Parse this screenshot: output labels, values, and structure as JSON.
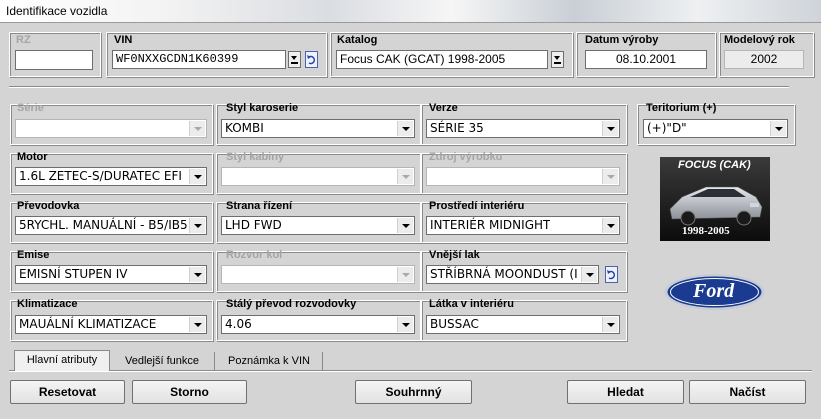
{
  "window": {
    "title": "Identifikace vozidla"
  },
  "top": {
    "rz": {
      "label": "RZ",
      "value": ""
    },
    "vin": {
      "label": "VIN",
      "value": "WF0NXXGCDN1K60399"
    },
    "katalog": {
      "label": "Katalog",
      "value": "Focus CAK (GCAT) 1998-2005"
    },
    "datum": {
      "label": "Datum výroby",
      "value": "08.10.2001"
    },
    "rok": {
      "label": "Modelový rok",
      "value": "2002"
    }
  },
  "attrs": {
    "serie": {
      "label": "Série",
      "value": ""
    },
    "styl_karoserie": {
      "label": "Styl karoserie",
      "value": "KOMBI"
    },
    "verze": {
      "label": "Verze",
      "value": "SÉRIE 35"
    },
    "teritorium": {
      "label": "Teritorium (+)",
      "value": "(+)\"D\""
    },
    "motor": {
      "label": "Motor",
      "value": "1.6L ZETEC-S/DURATEC EFI"
    },
    "styl_kabiny": {
      "label": "Styl kabiny",
      "value": ""
    },
    "zdroj_vyrobku": {
      "label": "Zdroj výrobku",
      "value": ""
    },
    "prevodovka": {
      "label": "Převodovka",
      "value": "5RYCHL. MANUÁLNÍ - B5/IB5"
    },
    "strana_rizeni": {
      "label": "Strana řízení",
      "value": "LHD FWD"
    },
    "prostredi_interieru": {
      "label": "Prostředí interiéru",
      "value": "INTERIÉR MIDNIGHT"
    },
    "emise": {
      "label": "Emise",
      "value": "EMISNÍ STUPEN IV"
    },
    "rozvor_kol": {
      "label": "Rozvor kol",
      "value": ""
    },
    "vnejsi_lak": {
      "label": "Vnější lak",
      "value": "STŘÍBRNÁ MOONDUST (I"
    },
    "klimatizace": {
      "label": "Klimatizace",
      "value": "MAUÁLNÍ KLIMATIZACE"
    },
    "staly_prevod": {
      "label": "Stálý převod rozvodovky",
      "value": "4.06"
    },
    "latka": {
      "label": "Látka v interiéru",
      "value": "BUSSAC"
    }
  },
  "image": {
    "caption_top": "FOCUS (CAK)",
    "caption_bottom": "1998-2005"
  },
  "logo": {
    "text": "Ford"
  },
  "tabs": [
    "Hlavní atributy",
    "Vedlejší funkce",
    "Poznámka k VIN"
  ],
  "buttons": {
    "reset": "Resetovat",
    "storno": "Storno",
    "souhrnny": "Souhrnný",
    "hledat": "Hledat",
    "nacist": "Načíst"
  },
  "colors": {
    "window_bg": "#d4d4d4",
    "disabled_text": "#a5a5a5",
    "ford_blue": "#1a3b8f"
  }
}
